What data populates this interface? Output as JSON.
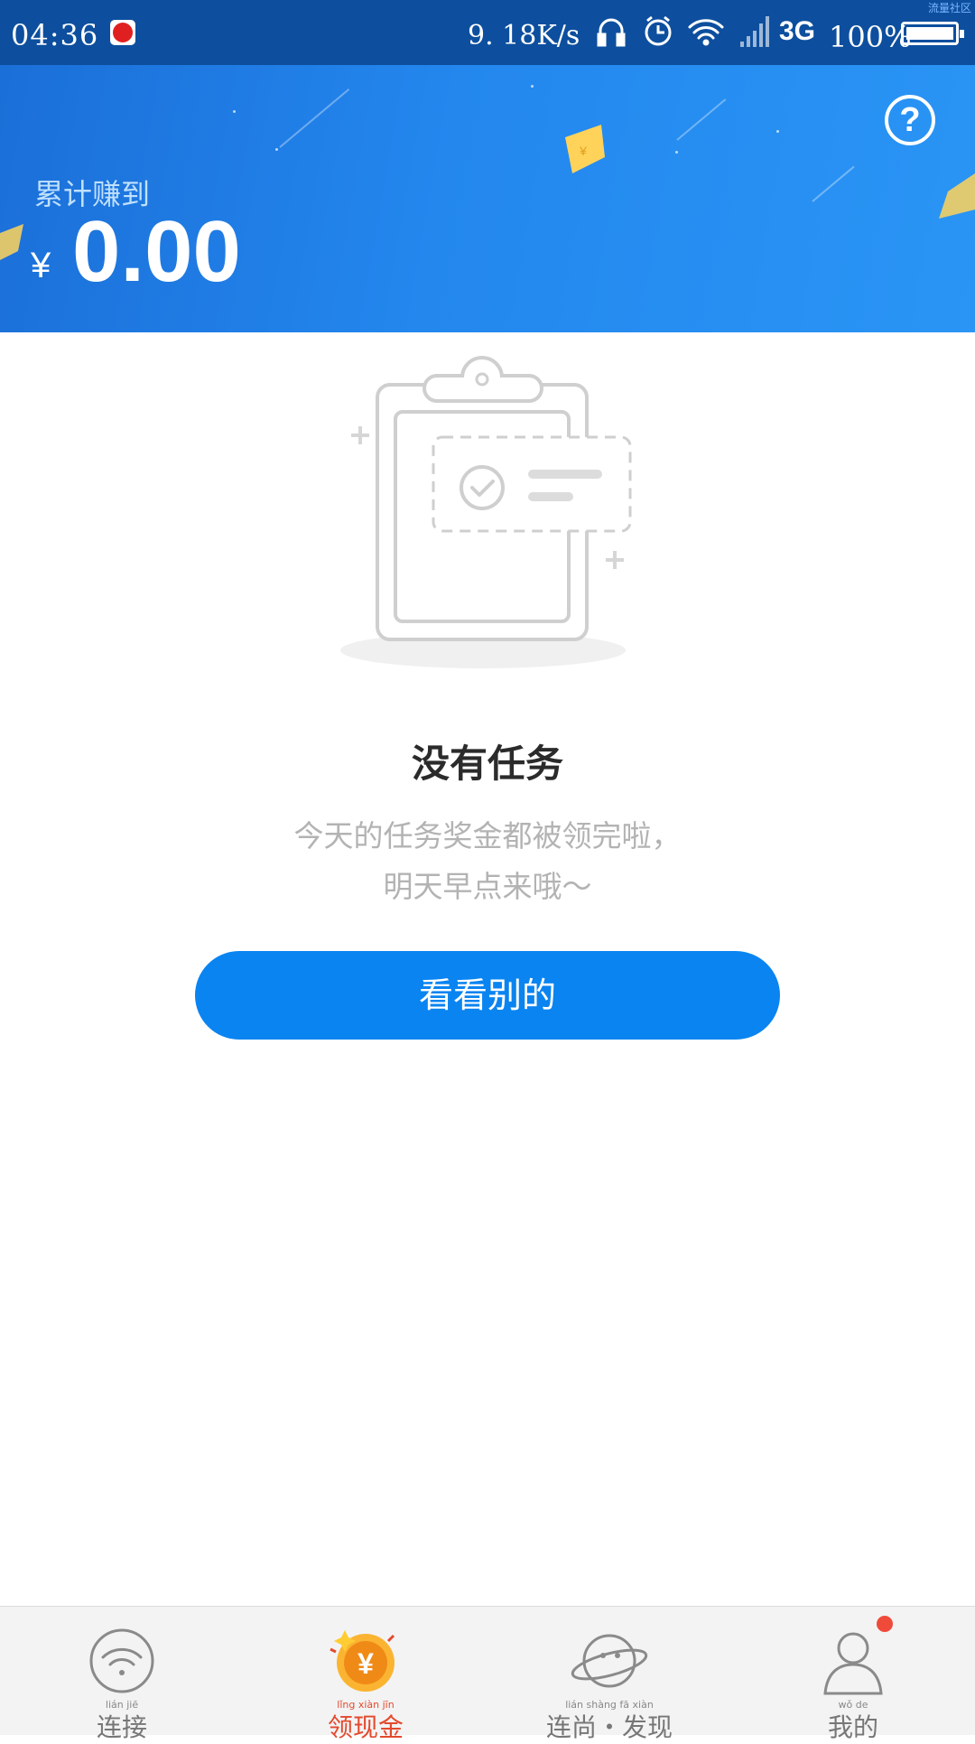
{
  "status_bar": {
    "time": "04:36",
    "net_speed": "9. 18K/s",
    "network_type": "3G",
    "battery": "100%",
    "watermark": "流量社区",
    "icons": [
      "netease-music-icon",
      "headphones-icon",
      "alarm-icon",
      "wifi-icon",
      "signal-icon",
      "battery-icon"
    ]
  },
  "header": {
    "earned_label": "累计赚到",
    "currency_symbol": "¥",
    "earned_amount": "0.00",
    "help_icon": "help-circle-icon"
  },
  "empty_state": {
    "title": "没有任务",
    "description_line1": "今天的任务奖金都被领完啦，",
    "description_line2": "明天早点来哦～",
    "button_label": "看看别的"
  },
  "bottom_nav": {
    "items": [
      {
        "label": "连接",
        "pinyin": "lián jiē",
        "icon": "wifi-icon",
        "active": false
      },
      {
        "label": "领现金",
        "pinyin": "lǐng xiàn jīn",
        "icon": "coin-icon",
        "active": true
      },
      {
        "label": "连尚・发现",
        "pinyin": "lián shàng fā xiàn",
        "icon": "planet-icon",
        "active": false
      },
      {
        "label": "我的",
        "pinyin": "wǒ de",
        "icon": "user-icon",
        "active": false,
        "has_badge": true
      }
    ]
  },
  "colors": {
    "status_bar": "#0d4f9e",
    "banner": "#2387ee",
    "primary_button": "#0a84f0",
    "active_tab": "#e34a2e",
    "badge": "#f04a3a"
  }
}
